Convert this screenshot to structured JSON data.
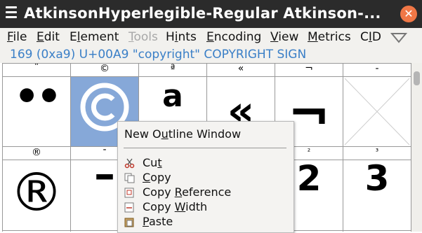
{
  "window": {
    "title": "AtkinsonHyperlegible-Regular  Atkinson-..."
  },
  "menubar": {
    "items": [
      {
        "label": "File",
        "u": "F",
        "rest": "ile"
      },
      {
        "label": "Edit",
        "u": "E",
        "rest": "dit"
      },
      {
        "label": "Element",
        "pre": "E",
        "u": "l",
        "rest": "ement"
      },
      {
        "label": "Tools",
        "u": "T",
        "rest": "ools"
      },
      {
        "label": "Hints",
        "pre": "H",
        "u": "i",
        "rest": "nts"
      },
      {
        "label": "Encoding",
        "u": "E",
        "rest": "ncoding"
      },
      {
        "label": "View",
        "u": "V",
        "rest": "iew"
      },
      {
        "label": "Metrics",
        "u": "M",
        "rest": "etrics"
      },
      {
        "label": "CID",
        "pre": "C",
        "u": "I",
        "rest": "D"
      }
    ]
  },
  "glyph_info": "169 (0xa9) U+00A9 \"copyright\" COPYRIGHT SIGN",
  "grid": {
    "row1_labels": [
      "¨",
      "©",
      "ª",
      "«",
      "¬",
      "-"
    ],
    "row1_glyphs": [
      "••",
      "©",
      "a",
      "«",
      "¬",
      ""
    ],
    "row2_labels": [
      "®",
      "-",
      "",
      "",
      "²",
      "³"
    ],
    "row2_glyphs": [
      "®",
      "–",
      "",
      "",
      "2",
      "3"
    ]
  },
  "context_menu": {
    "items": [
      {
        "label": "New Outline Window",
        "pre": "New O",
        "u": "u",
        "rest": "tline Window",
        "icon": ""
      },
      {
        "label": "Cut",
        "pre": "Cu",
        "u": "t",
        "rest": "",
        "icon": "scissors-icon"
      },
      {
        "label": "Copy",
        "pre": "",
        "u": "C",
        "rest": "opy",
        "icon": "copy-icon"
      },
      {
        "label": "Copy Reference",
        "pre": "Copy ",
        "u": "R",
        "rest": "eference",
        "icon": "copy-reference-icon"
      },
      {
        "label": "Copy Width",
        "pre": "Copy ",
        "u": "W",
        "rest": "idth",
        "icon": "copy-width-icon"
      },
      {
        "label": "Paste",
        "pre": "",
        "u": "P",
        "rest": "aste",
        "icon": "paste-icon"
      }
    ]
  },
  "colors": {
    "titlebar": "#2b2b2b",
    "selection": "#86a8d8",
    "info_text": "#3a7fc7",
    "close": "#f07746"
  }
}
